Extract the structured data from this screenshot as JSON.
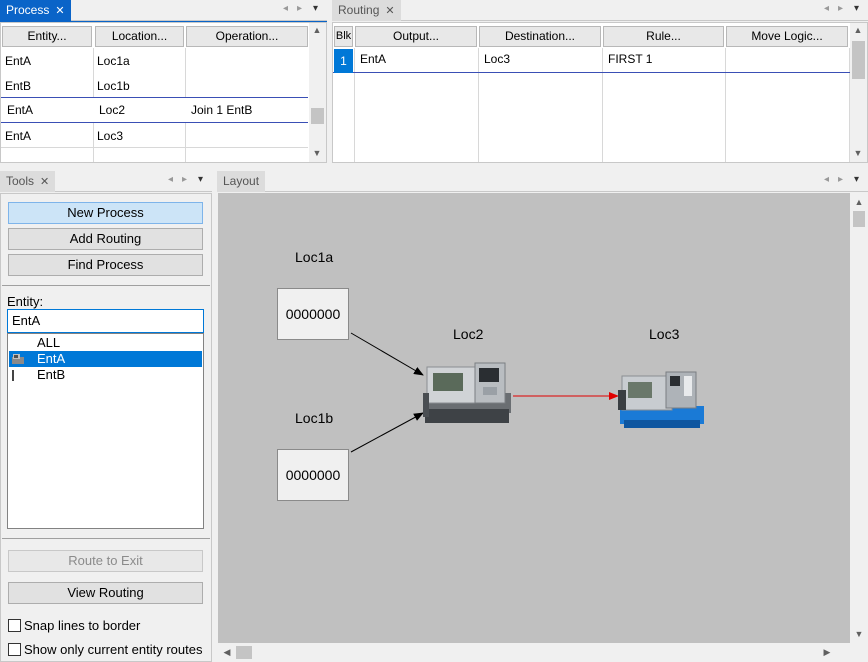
{
  "process_panel": {
    "tab_label": "Process",
    "columns": [
      "Entity...",
      "Location...",
      "Operation..."
    ],
    "rows": [
      {
        "entity": "EntA",
        "location": "Loc1a",
        "operation": ""
      },
      {
        "entity": "EntB",
        "location": "Loc1b",
        "operation": ""
      },
      {
        "entity": "EntA",
        "location": "Loc2",
        "operation": "Join 1 EntB"
      },
      {
        "entity": "EntA",
        "location": "Loc3",
        "operation": ""
      }
    ]
  },
  "routing_panel": {
    "tab_label": "Routing",
    "columns": [
      "Blk",
      "Output...",
      "Destination...",
      "Rule...",
      "Move Logic..."
    ],
    "rows": [
      {
        "blk": "1",
        "output": "EntA",
        "destination": "Loc3",
        "rule": "FIRST 1",
        "move_logic": ""
      }
    ]
  },
  "tools_panel": {
    "tab_label": "Tools",
    "new_process": "New Process",
    "add_routing": "Add Routing",
    "find_process": "Find Process",
    "entity_label": "Entity:",
    "entity_value": "EntA",
    "entity_list": [
      "ALL",
      "EntA",
      "EntB"
    ],
    "selected_entity": "EntA",
    "route_to_exit": "Route to Exit",
    "view_routing": "View Routing",
    "snap_lines": "Snap lines to border",
    "show_only_current": "Show only current entity routes",
    "snap_checked": false,
    "show_only_checked": false
  },
  "layout_panel": {
    "tab_label": "Layout",
    "locations": [
      {
        "name": "Loc1a",
        "counter": "0000000"
      },
      {
        "name": "Loc1b",
        "counter": "0000000"
      },
      {
        "name": "Loc2"
      },
      {
        "name": "Loc3"
      }
    ]
  },
  "colors": {
    "active_tab": "#0a64c8",
    "selection": "#0078d7",
    "canvas": "#c0c0c0",
    "route_black": "#000000",
    "route_red": "#e00000"
  }
}
